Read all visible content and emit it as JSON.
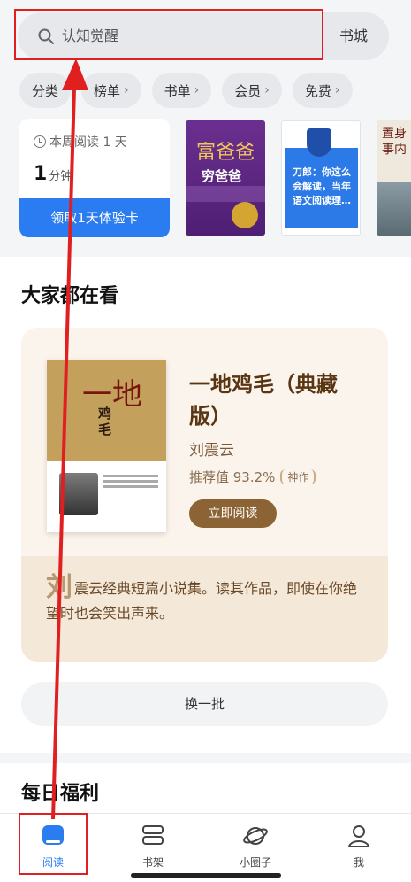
{
  "search": {
    "placeholder": "认知觉醒",
    "store_label": "书城"
  },
  "categories": [
    {
      "label": "分类",
      "has_chevron": false
    },
    {
      "label": "榜单",
      "has_chevron": true
    },
    {
      "label": "书单",
      "has_chevron": true
    },
    {
      "label": "会员",
      "has_chevron": true
    },
    {
      "label": "免费",
      "has_chevron": true
    }
  ],
  "vip_card": {
    "today_label": "本周阅读 1 天",
    "minutes": "1",
    "minutes_unit": "分钟",
    "claim_label": "领取1天体验卡"
  },
  "recent_books": [
    {
      "title_top": "富爸爸",
      "title_bottom": "穷爸爸"
    },
    {
      "title": "刀郎：你这么会解读，当年语文阅读理…",
      "tag": "好书"
    },
    {
      "title": "置身事内"
    }
  ],
  "everyone_reading": {
    "section_title": "大家都在看",
    "book_title": "一地鸡毛（典藏版）",
    "cover_title_big": "一地",
    "cover_title_small": "鸡毛",
    "author": "刘震云",
    "recommend": "推荐值 93.2%",
    "badge": "神作",
    "read_button": "立即阅读",
    "desc_first_char": "刘",
    "description": "震云经典短篇小说集。读其作品，即使在你绝望时也会笑出声来。",
    "refresh_label": "换一批"
  },
  "daily_welfare": {
    "section_title": "每日福利"
  },
  "tabbar": {
    "active": "阅读",
    "items": [
      {
        "label": "阅读",
        "icon": "book-open-icon"
      },
      {
        "label": "书架",
        "icon": "bookshelf-icon"
      },
      {
        "label": "小圈子",
        "icon": "planet-icon"
      },
      {
        "label": "我",
        "icon": "person-icon"
      }
    ]
  },
  "colors": {
    "accent_blue": "#2b7cf0",
    "annotation_red": "#e02020",
    "feature_brown": "#8c6334"
  }
}
